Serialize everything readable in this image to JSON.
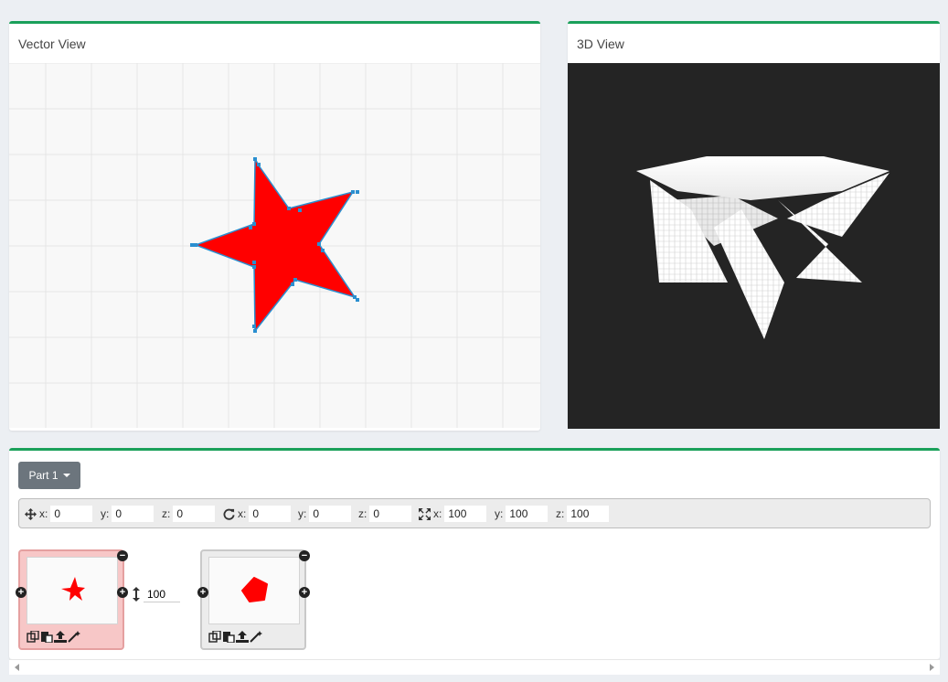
{
  "vector_view": {
    "title": "Vector View",
    "star_fill": "#ff0000",
    "stroke": "#2a8fd0"
  },
  "threed_view": {
    "title": "3D View"
  },
  "parts": {
    "selected": "Part 1"
  },
  "transform": {
    "position": {
      "x_label": "x:",
      "x": "0",
      "y_label": "y:",
      "y": "0",
      "z_label": "z:",
      "z": "0"
    },
    "rotation": {
      "x_label": "x:",
      "x": "0",
      "y_label": "y:",
      "y": "0",
      "z_label": "z:",
      "z": "0"
    },
    "scale": {
      "x_label": "x:",
      "x": "100",
      "y_label": "y:",
      "y": "100",
      "z_label": "z:",
      "z": "100"
    }
  },
  "layers": [
    {
      "shape": "star",
      "active": true
    },
    {
      "shape": "pentagon",
      "active": false
    }
  ],
  "spacing": {
    "value": "100"
  },
  "colors": {
    "accent": "#1aa05a",
    "dropdown": "#6c757d",
    "shape_fill": "#ff0000",
    "layer_active": "#f7c7c7"
  },
  "icons": [
    "move-icon",
    "rotate-icon",
    "scale-icon",
    "copy-icon",
    "paste-icon",
    "upload-icon",
    "magic-wand-icon",
    "plus-icon",
    "minus-icon",
    "vertical-arrows-icon"
  ]
}
